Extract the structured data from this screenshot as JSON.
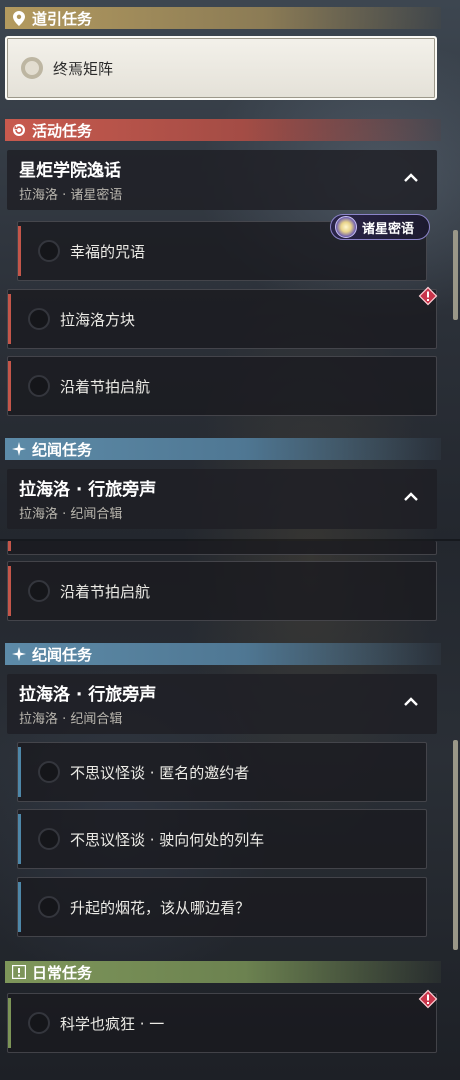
{
  "sections": {
    "guide": {
      "label": "道引任务",
      "icon": "map-pin-icon"
    },
    "event": {
      "label": "活动任务",
      "icon": "refresh-icon"
    },
    "story": {
      "label": "纪闻任务",
      "icon": "sparkle-icon"
    },
    "daily": {
      "label": "日常任务",
      "icon": "alert-box-icon"
    }
  },
  "guide_quest": {
    "title": "终焉矩阵"
  },
  "event_group": {
    "title": "星炬学院逸话",
    "subtitle": "拉海洛 · 诸星密语"
  },
  "event_quests": [
    "幸福的咒语",
    "拉海洛方块",
    "沿着节拍启航",
    "沿着节拍启航"
  ],
  "event_tag": {
    "label": "诸星密语"
  },
  "story_group": {
    "title": "拉海洛 · 行旅旁声",
    "subtitle": "拉海洛 · 纪闻合辑"
  },
  "story_quests": [
    "不思议怪谈 · 匿名的邀约者",
    "不思议怪谈 · 驶向何处的列车",
    "升起的烟花，该从哪边看？"
  ],
  "daily_quests": [
    "科学也疯狂 · 一"
  ],
  "colors": {
    "guide": "#b39a5f",
    "event": "#c85a4e",
    "story": "#5d8ba8",
    "daily": "#7e965a",
    "warning": "#c8344a"
  }
}
